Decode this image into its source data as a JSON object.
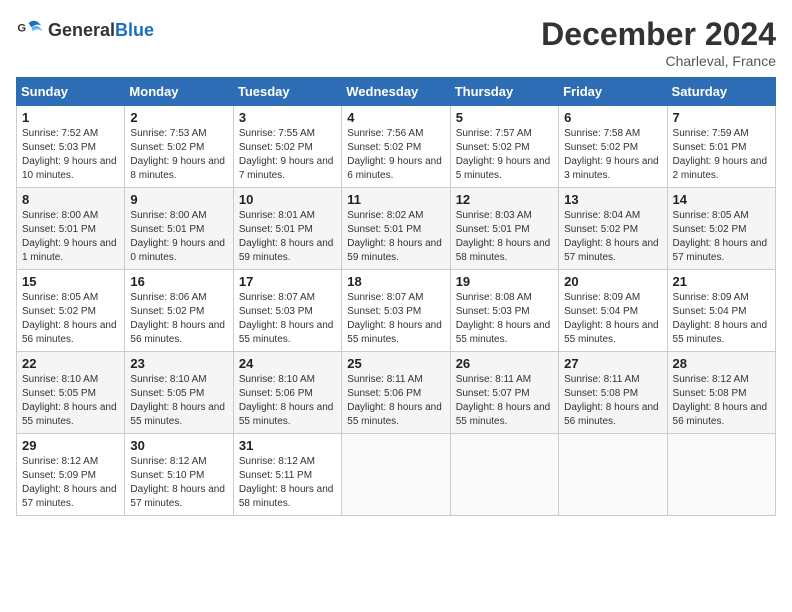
{
  "header": {
    "logo_general": "General",
    "logo_blue": "Blue",
    "month_title": "December 2024",
    "location": "Charleval, France"
  },
  "weekdays": [
    "Sunday",
    "Monday",
    "Tuesday",
    "Wednesday",
    "Thursday",
    "Friday",
    "Saturday"
  ],
  "weeks": [
    [
      {
        "day": "1",
        "info": "Sunrise: 7:52 AM\nSunset: 5:03 PM\nDaylight: 9 hours and 10 minutes."
      },
      {
        "day": "2",
        "info": "Sunrise: 7:53 AM\nSunset: 5:02 PM\nDaylight: 9 hours and 8 minutes."
      },
      {
        "day": "3",
        "info": "Sunrise: 7:55 AM\nSunset: 5:02 PM\nDaylight: 9 hours and 7 minutes."
      },
      {
        "day": "4",
        "info": "Sunrise: 7:56 AM\nSunset: 5:02 PM\nDaylight: 9 hours and 6 minutes."
      },
      {
        "day": "5",
        "info": "Sunrise: 7:57 AM\nSunset: 5:02 PM\nDaylight: 9 hours and 5 minutes."
      },
      {
        "day": "6",
        "info": "Sunrise: 7:58 AM\nSunset: 5:02 PM\nDaylight: 9 hours and 3 minutes."
      },
      {
        "day": "7",
        "info": "Sunrise: 7:59 AM\nSunset: 5:01 PM\nDaylight: 9 hours and 2 minutes."
      }
    ],
    [
      {
        "day": "8",
        "info": "Sunrise: 8:00 AM\nSunset: 5:01 PM\nDaylight: 9 hours and 1 minute."
      },
      {
        "day": "9",
        "info": "Sunrise: 8:00 AM\nSunset: 5:01 PM\nDaylight: 9 hours and 0 minutes."
      },
      {
        "day": "10",
        "info": "Sunrise: 8:01 AM\nSunset: 5:01 PM\nDaylight: 8 hours and 59 minutes."
      },
      {
        "day": "11",
        "info": "Sunrise: 8:02 AM\nSunset: 5:01 PM\nDaylight: 8 hours and 59 minutes."
      },
      {
        "day": "12",
        "info": "Sunrise: 8:03 AM\nSunset: 5:01 PM\nDaylight: 8 hours and 58 minutes."
      },
      {
        "day": "13",
        "info": "Sunrise: 8:04 AM\nSunset: 5:02 PM\nDaylight: 8 hours and 57 minutes."
      },
      {
        "day": "14",
        "info": "Sunrise: 8:05 AM\nSunset: 5:02 PM\nDaylight: 8 hours and 57 minutes."
      }
    ],
    [
      {
        "day": "15",
        "info": "Sunrise: 8:05 AM\nSunset: 5:02 PM\nDaylight: 8 hours and 56 minutes."
      },
      {
        "day": "16",
        "info": "Sunrise: 8:06 AM\nSunset: 5:02 PM\nDaylight: 8 hours and 56 minutes."
      },
      {
        "day": "17",
        "info": "Sunrise: 8:07 AM\nSunset: 5:03 PM\nDaylight: 8 hours and 55 minutes."
      },
      {
        "day": "18",
        "info": "Sunrise: 8:07 AM\nSunset: 5:03 PM\nDaylight: 8 hours and 55 minutes."
      },
      {
        "day": "19",
        "info": "Sunrise: 8:08 AM\nSunset: 5:03 PM\nDaylight: 8 hours and 55 minutes."
      },
      {
        "day": "20",
        "info": "Sunrise: 8:09 AM\nSunset: 5:04 PM\nDaylight: 8 hours and 55 minutes."
      },
      {
        "day": "21",
        "info": "Sunrise: 8:09 AM\nSunset: 5:04 PM\nDaylight: 8 hours and 55 minutes."
      }
    ],
    [
      {
        "day": "22",
        "info": "Sunrise: 8:10 AM\nSunset: 5:05 PM\nDaylight: 8 hours and 55 minutes."
      },
      {
        "day": "23",
        "info": "Sunrise: 8:10 AM\nSunset: 5:05 PM\nDaylight: 8 hours and 55 minutes."
      },
      {
        "day": "24",
        "info": "Sunrise: 8:10 AM\nSunset: 5:06 PM\nDaylight: 8 hours and 55 minutes."
      },
      {
        "day": "25",
        "info": "Sunrise: 8:11 AM\nSunset: 5:06 PM\nDaylight: 8 hours and 55 minutes."
      },
      {
        "day": "26",
        "info": "Sunrise: 8:11 AM\nSunset: 5:07 PM\nDaylight: 8 hours and 55 minutes."
      },
      {
        "day": "27",
        "info": "Sunrise: 8:11 AM\nSunset: 5:08 PM\nDaylight: 8 hours and 56 minutes."
      },
      {
        "day": "28",
        "info": "Sunrise: 8:12 AM\nSunset: 5:08 PM\nDaylight: 8 hours and 56 minutes."
      }
    ],
    [
      {
        "day": "29",
        "info": "Sunrise: 8:12 AM\nSunset: 5:09 PM\nDaylight: 8 hours and 57 minutes."
      },
      {
        "day": "30",
        "info": "Sunrise: 8:12 AM\nSunset: 5:10 PM\nDaylight: 8 hours and 57 minutes."
      },
      {
        "day": "31",
        "info": "Sunrise: 8:12 AM\nSunset: 5:11 PM\nDaylight: 8 hours and 58 minutes."
      },
      {
        "day": "",
        "info": ""
      },
      {
        "day": "",
        "info": ""
      },
      {
        "day": "",
        "info": ""
      },
      {
        "day": "",
        "info": ""
      }
    ]
  ]
}
